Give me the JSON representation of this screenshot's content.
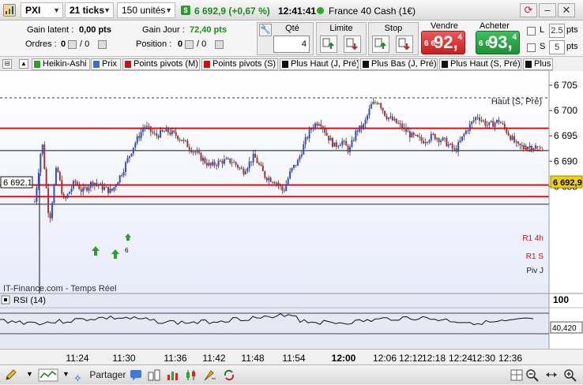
{
  "topbar": {
    "symbol": "PXI",
    "ticks": "21 ticks",
    "units": "150 unités",
    "price_change": "6 692,9 (+0,67 %)",
    "time": "12:41:41",
    "instrument": "France 40 Cash (1€)"
  },
  "info": {
    "gain_latent_label": "Gain latent :",
    "gain_latent_value": "0,00 pts",
    "gain_jour_label": "Gain Jour :",
    "gain_jour_value": "72,40 pts",
    "ordres_label": "Ordres :",
    "ordres_value": "0",
    "ordres_sep": "/ 0",
    "position_label": "Position :",
    "position_value": "0",
    "position_sep": "/ 0"
  },
  "order": {
    "qte_label": "Qté",
    "qte_value": "4",
    "limite_label": "Limite",
    "stop_label": "Stop",
    "vendre_label": "Vendre",
    "vendre_prefix": "6 6",
    "vendre_big": "92,",
    "vendre_sup": "4",
    "acheter_label": "Acheter",
    "acheter_prefix": "6 6",
    "acheter_big": "93,",
    "acheter_sup": "4",
    "l_label": "L",
    "l_value": "2.5",
    "l_unit": "pts",
    "s_label": "S",
    "s_value": "5",
    "s_unit": "pts"
  },
  "tabs": [
    {
      "label": "Heikin-Ashi",
      "color": "#2aa02a"
    },
    {
      "label": "Prix",
      "color": "#3a6fd0"
    },
    {
      "label": "Points pivots (M)",
      "color": "#d01010"
    },
    {
      "label": "Points pivots (S)",
      "color": "#d01010"
    },
    {
      "label": "Plus Haut (J, Pré)",
      "color": "#111111"
    },
    {
      "label": "Plus Bas (J, Pré)",
      "color": "#111111"
    },
    {
      "label": "Plus Haut (S, Pré)",
      "color": "#111111"
    },
    {
      "label": "Plus",
      "color": "#111111"
    }
  ],
  "chart_labels": {
    "haut_s_pre": "Haut (S, Pré)",
    "r2_4h": "R2 4h",
    "r1_4h": "R1 4h",
    "r1_s": "R1 S",
    "piv_j": "Piv J",
    "crosshair_value": "6 692,1",
    "current_price": "6 692,9",
    "watermark": "IT-Finance.com - Temps Réel",
    "signal_count": "6",
    "rsi_title": "RSI (14)",
    "rsi_scale_top": "100",
    "rsi_current": "40,420"
  },
  "bottombar": {
    "share_label": "Partager"
  },
  "chart_data": {
    "type": "candlestick",
    "title": "",
    "y_ticks": [
      6705,
      6700,
      6695,
      6690,
      6685
    ],
    "y_tick_labels": [
      "6 705",
      "6 700",
      "6 695",
      "6 690",
      "6 685"
    ],
    "x_tick_labels": [
      "11:24",
      "11:30",
      "11:36",
      "11:42",
      "11:48",
      "11:54",
      "12:00",
      "12:06",
      "12:12",
      "12:18",
      "12:24",
      "12:30",
      "12:36"
    ],
    "levels": [
      {
        "name": "Haut (S, Pré)",
        "value": 6702.5,
        "style": "dashed",
        "color": "#333333"
      },
      {
        "name": "R2 4h",
        "value": 6696.5,
        "style": "solid",
        "color": "#dd1111"
      },
      {
        "name": "R1 4h",
        "value": 6685.3,
        "style": "solid",
        "color": "#dd1111"
      },
      {
        "name": "R1 S",
        "value": 6683.0,
        "style": "solid",
        "color": "#dd1111"
      },
      {
        "name": "Piv J",
        "value": 6681.5,
        "style": "solid",
        "color": "#222222"
      },
      {
        "name": "crosshair",
        "value": 6692.1,
        "style": "solid",
        "color": "#111111"
      }
    ],
    "close_path": [
      [
        11.25,
        6682
      ],
      [
        11.27,
        6694
      ],
      [
        11.29,
        6678
      ],
      [
        11.31,
        6689
      ],
      [
        11.33,
        6682
      ],
      [
        11.36,
        6686
      ],
      [
        11.38,
        6684
      ],
      [
        11.41,
        6686
      ],
      [
        11.43,
        6685
      ],
      [
        11.46,
        6684
      ],
      [
        11.49,
        6688
      ],
      [
        11.52,
        6693
      ],
      [
        11.55,
        6697
      ],
      [
        11.58,
        6695
      ],
      [
        11.61,
        6696
      ],
      [
        11.64,
        6695
      ],
      [
        11.67,
        6693
      ],
      [
        11.7,
        6691
      ],
      [
        11.73,
        6689
      ],
      [
        11.76,
        6690
      ],
      [
        11.79,
        6690
      ],
      [
        11.82,
        6688
      ],
      [
        11.85,
        6691
      ],
      [
        11.88,
        6687
      ],
      [
        11.91,
        6686
      ],
      [
        11.93,
        6684
      ],
      [
        11.95,
        6688
      ],
      [
        11.97,
        6690
      ],
      [
        11.99,
        6694
      ],
      [
        12.01,
        6697
      ],
      [
        12.03,
        6698
      ],
      [
        12.05,
        6695
      ],
      [
        12.07,
        6693
      ],
      [
        12.09,
        6694
      ],
      [
        12.11,
        6692
      ],
      [
        12.13,
        6696
      ],
      [
        12.15,
        6697
      ],
      [
        12.17,
        6701
      ],
      [
        12.19,
        6702
      ],
      [
        12.21,
        6699
      ],
      [
        12.23,
        6698
      ],
      [
        12.25,
        6697
      ],
      [
        12.28,
        6695
      ],
      [
        12.31,
        6694
      ],
      [
        12.34,
        6695
      ],
      [
        12.37,
        6694
      ],
      [
        12.4,
        6692
      ],
      [
        12.43,
        6696
      ],
      [
        12.46,
        6699
      ],
      [
        12.49,
        6697
      ],
      [
        12.52,
        6698
      ],
      [
        12.55,
        6695
      ],
      [
        12.57,
        6692.9
      ]
    ],
    "current_price": 6692.9,
    "rsi": {
      "name": "RSI (14)",
      "current": 40.42,
      "max": 100
    }
  }
}
